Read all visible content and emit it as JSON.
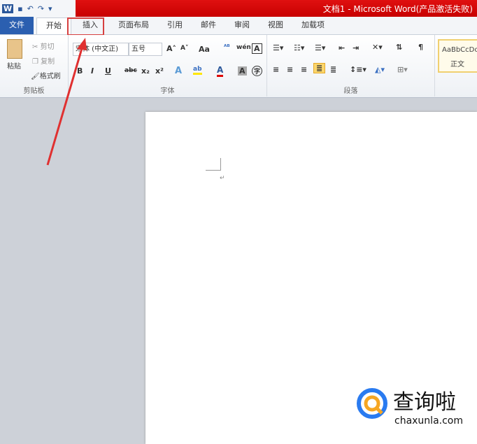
{
  "quick_access": {
    "icons": [
      "word-icon",
      "save-icon",
      "undo-icon",
      "redo-icon",
      "customize-icon"
    ]
  },
  "title": "文档1 - Microsoft Word(产品激活失败)",
  "tabs": [
    "文件",
    "开始",
    "插入",
    "页面布局",
    "引用",
    "邮件",
    "审阅",
    "视图",
    "加载项"
  ],
  "clipboard": {
    "paste": "粘贴",
    "cut": "剪切",
    "copy": "复制",
    "format_painter": "格式刷",
    "label": "剪贴板"
  },
  "font": {
    "font_name": "宋体 (中文正)",
    "font_size": "五号",
    "label": "字体",
    "bold": "B",
    "italic": "I",
    "underline": "U",
    "strike": "abc",
    "sub": "x₂",
    "sup": "x²",
    "change_case": "Aa",
    "grow": "A˄",
    "shrink": "A˅",
    "char_border": "A",
    "phonetic": "wén",
    "enclose": "字"
  },
  "paragraph": {
    "label": "段落"
  },
  "styles": {
    "preview": "AaBbCcDc",
    "name": "正文"
  },
  "document": {
    "para_mark": "↵"
  },
  "watermark": {
    "name": "查询啦",
    "url": "chaxunla.com"
  },
  "colors": {
    "title_bar": "#d40000",
    "file_tab": "#2b5fb0",
    "highlight": "#d64040"
  }
}
